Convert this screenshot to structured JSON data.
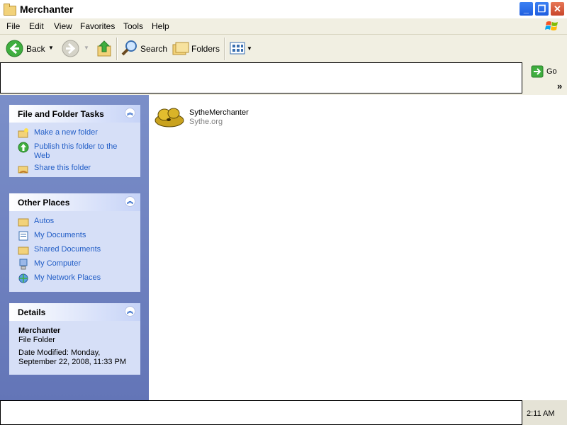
{
  "window": {
    "title": "Merchanter"
  },
  "menu": [
    "File",
    "Edit",
    "View",
    "Favorites",
    "Tools",
    "Help"
  ],
  "toolbar": {
    "back": "Back",
    "search": "Search",
    "folders": "Folders"
  },
  "address": {
    "go": "Go",
    "links_chevron": "»"
  },
  "tasks_panel": {
    "title": "File and Folder Tasks",
    "items": [
      "Make a new folder",
      "Publish this folder to the Web",
      "Share this folder"
    ]
  },
  "places_panel": {
    "title": "Other Places",
    "items": [
      "Autos",
      "My Documents",
      "Shared Documents",
      "My Computer",
      "My Network Places"
    ]
  },
  "details_panel": {
    "title": "Details",
    "name": "Merchanter",
    "type": "File Folder",
    "modified": "Date Modified: Monday, September 22, 2008, 11:33 PM"
  },
  "file_item": {
    "name": "SytheMerchanter",
    "subtitle": "Sythe.org"
  },
  "taskbar": {
    "clock": "2:11 AM"
  },
  "colors": {
    "link_blue": "#215dc6",
    "pane_blue": "#6375b7",
    "panel_body": "#d6dff7"
  }
}
